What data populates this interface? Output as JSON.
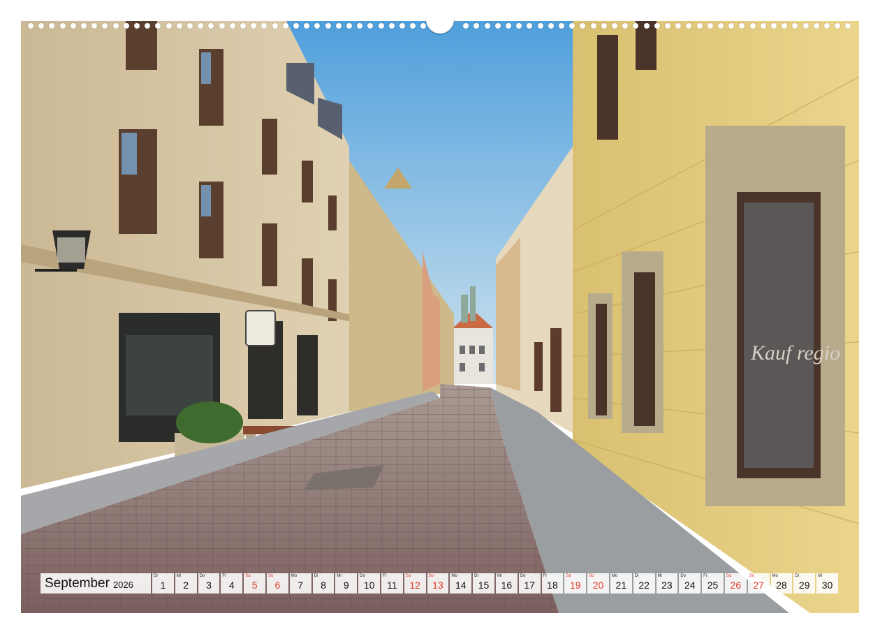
{
  "calendar": {
    "month": "September",
    "year": "2026",
    "weekend_color": "#e03a2a",
    "days": [
      {
        "wd": "Di",
        "num": "1",
        "weekend": false
      },
      {
        "wd": "Mi",
        "num": "2",
        "weekend": false
      },
      {
        "wd": "Do",
        "num": "3",
        "weekend": false
      },
      {
        "wd": "Fr",
        "num": "4",
        "weekend": false
      },
      {
        "wd": "Sa",
        "num": "5",
        "weekend": true
      },
      {
        "wd": "So",
        "num": "6",
        "weekend": true
      },
      {
        "wd": "Mo",
        "num": "7",
        "weekend": false
      },
      {
        "wd": "Di",
        "num": "8",
        "weekend": false
      },
      {
        "wd": "Mi",
        "num": "9",
        "weekend": false
      },
      {
        "wd": "Do",
        "num": "10",
        "weekend": false
      },
      {
        "wd": "Fr",
        "num": "11",
        "weekend": false
      },
      {
        "wd": "Sa",
        "num": "12",
        "weekend": true
      },
      {
        "wd": "So",
        "num": "13",
        "weekend": true
      },
      {
        "wd": "Mo",
        "num": "14",
        "weekend": false
      },
      {
        "wd": "Di",
        "num": "15",
        "weekend": false
      },
      {
        "wd": "Mi",
        "num": "16",
        "weekend": false
      },
      {
        "wd": "Do",
        "num": "17",
        "weekend": false
      },
      {
        "wd": "Fr",
        "num": "18",
        "weekend": false
      },
      {
        "wd": "Sa",
        "num": "19",
        "weekend": true
      },
      {
        "wd": "So",
        "num": "20",
        "weekend": true
      },
      {
        "wd": "Mo",
        "num": "21",
        "weekend": false
      },
      {
        "wd": "Di",
        "num": "22",
        "weekend": false
      },
      {
        "wd": "Mi",
        "num": "23",
        "weekend": false
      },
      {
        "wd": "Do",
        "num": "24",
        "weekend": false
      },
      {
        "wd": "Fr",
        "num": "25",
        "weekend": false
      },
      {
        "wd": "Sa",
        "num": "26",
        "weekend": true
      },
      {
        "wd": "So",
        "num": "27",
        "weekend": true
      },
      {
        "wd": "Mo",
        "num": "28",
        "weekend": false
      },
      {
        "wd": "Di",
        "num": "29",
        "weekend": false
      },
      {
        "wd": "Mi",
        "num": "30",
        "weekend": false
      }
    ]
  },
  "photo": {
    "sky_color": "#6fb2e3",
    "left_facade_color": "#d8c7a6",
    "right_facade_color": "#e6cf7e",
    "cobblestone_color": "#8a6e6a",
    "shop_sign_text": "Kauf regio"
  }
}
